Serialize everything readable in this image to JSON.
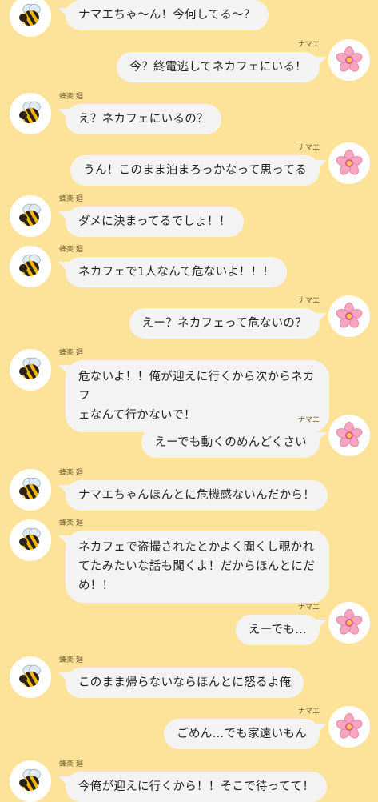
{
  "chat": {
    "messages": [
      {
        "side": "left",
        "name": "",
        "lines": [
          "ナマエちゃ〜ん！今何してる〜？"
        ],
        "avatar": "bee-icon"
      },
      {
        "side": "right",
        "name": "ナマエ",
        "lines": [
          "今？終電逃してネカフェにいる！"
        ],
        "avatar": "cherry-blossom-icon"
      },
      {
        "side": "left",
        "name": "蜂楽 廻",
        "lines": [
          "え？ネカフェにいるの？"
        ],
        "avatar": "bee-icon"
      },
      {
        "side": "right",
        "name": "ナマエ",
        "lines": [
          "うん！このまま泊まろっかなって思ってる"
        ],
        "avatar": "cherry-blossom-icon"
      },
      {
        "side": "left",
        "name": "蜂楽 廻",
        "lines": [
          "ダメに決まってるでしょ！！"
        ],
        "avatar": "bee-icon"
      },
      {
        "side": "left",
        "name": "蜂楽 廻",
        "lines": [
          "ネカフェで1人なんて危ないよ！！！"
        ],
        "avatar": "bee-icon"
      },
      {
        "side": "right",
        "name": "ナマエ",
        "lines": [
          "えー？ネカフェって危ないの？"
        ],
        "avatar": "cherry-blossom-icon"
      },
      {
        "side": "left",
        "name": "蜂楽 廻",
        "lines": [
          "危ないよ！！俺が迎えに行くから次からネカフ",
          "ェなんて行かないで！"
        ],
        "avatar": "bee-icon"
      },
      {
        "side": "right",
        "name": "ナマエ",
        "lines": [
          "えーでも動くのめんどくさい"
        ],
        "avatar": "cherry-blossom-icon"
      },
      {
        "side": "left",
        "name": "蜂楽 廻",
        "lines": [
          "ナマエちゃんほんとに危機感ないんだから！"
        ],
        "avatar": "bee-icon"
      },
      {
        "side": "left",
        "name": "蜂楽 廻",
        "lines": [
          "ネカフェで盗撮されたとかよく聞くし覗かれ",
          "てたみたいな話も聞くよ！だからほんとにだ",
          "め！！"
        ],
        "avatar": "bee-icon"
      },
      {
        "side": "right",
        "name": "ナマエ",
        "lines": [
          "えーでも…"
        ],
        "avatar": "cherry-blossom-icon"
      },
      {
        "side": "left",
        "name": "蜂楽 廻",
        "lines": [
          "このまま帰らないならほんとに怒るよ俺"
        ],
        "avatar": "bee-icon"
      },
      {
        "side": "right",
        "name": "ナマエ",
        "lines": [
          "ごめん…でも家遠いもん"
        ],
        "avatar": "cherry-blossom-icon"
      },
      {
        "side": "left",
        "name": "蜂楽 廻",
        "lines": [
          "今俺が迎えに行くから！！そこで待ってて！"
        ],
        "avatar": "bee-icon"
      }
    ]
  }
}
